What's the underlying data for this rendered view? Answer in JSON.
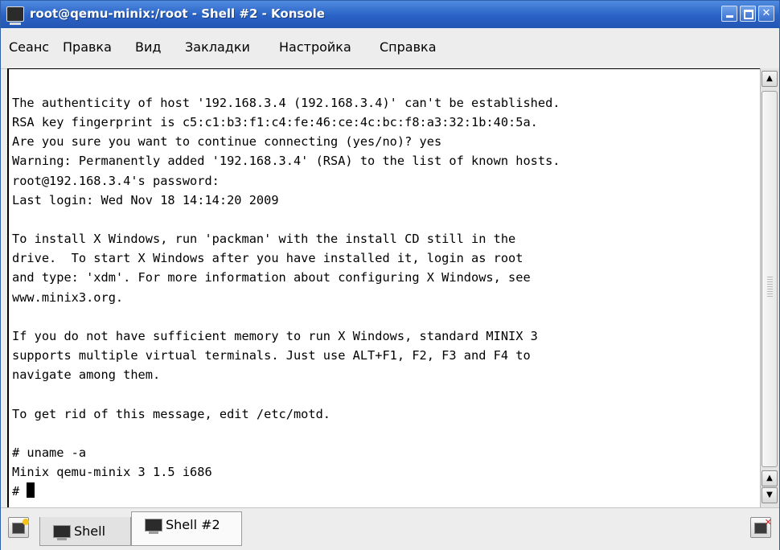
{
  "window": {
    "title": "root@qemu-minix:/root - Shell #2 - Konsole",
    "controls": {
      "minimize": "_",
      "maximize": "□",
      "close": "✕"
    }
  },
  "menubar": {
    "items": [
      "Сеанс",
      "Правка",
      "Вид",
      "Закладки",
      "Настройка",
      "Справка"
    ]
  },
  "terminal": {
    "lines": [
      "The authenticity of host '192.168.3.4 (192.168.3.4)' can't be established.",
      "RSA key fingerprint is c5:c1:b3:f1:c4:fe:46:ce:4c:bc:f8:a3:32:1b:40:5a.",
      "Are you sure you want to continue connecting (yes/no)? yes",
      "Warning: Permanently added '192.168.3.4' (RSA) to the list of known hosts.",
      "root@192.168.3.4's password:",
      "Last login: Wed Nov 18 14:14:20 2009",
      "",
      "To install X Windows, run 'packman' with the install CD still in the",
      "drive.  To start X Windows after you have installed it, login as root",
      "and type: 'xdm'. For more information about configuring X Windows, see",
      "www.minix3.org.",
      "",
      "If you do not have sufficient memory to run X Windows, standard MINIX 3",
      "supports multiple virtual terminals. Just use ALT+F1, F2, F3 and F4 to",
      "navigate among them.",
      "",
      "To get rid of this message, edit /etc/motd.",
      "",
      "# uname -a",
      "Minix qemu-minix 3 1.5 i686"
    ],
    "prompt": "# "
  },
  "tabs": [
    {
      "label": "Shell",
      "active": false
    },
    {
      "label": "Shell #2",
      "active": true
    }
  ],
  "icons": {
    "app": "terminal-icon",
    "new_tab": "new-session-icon",
    "close_tab": "close-session-icon",
    "scroll_up": "arrow-up-icon",
    "scroll_down": "arrow-down-icon"
  },
  "colors": {
    "titlebar": "#2a62c5",
    "terminal_bg": "#ffffff",
    "terminal_fg": "#000000"
  }
}
